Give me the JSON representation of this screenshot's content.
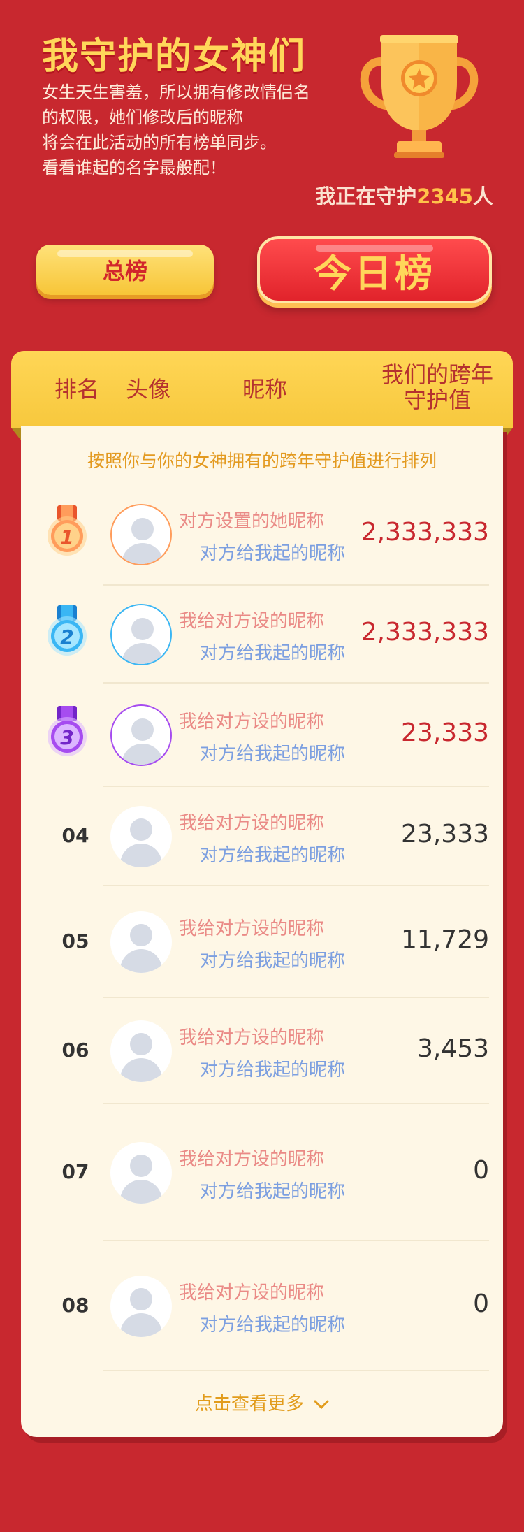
{
  "header": {
    "title": "我守护的女神们",
    "desc_lines": [
      "女生天生害羞，所以拥有修改情侣名",
      "的权限，她们修改后的昵称",
      "将会在此活动的所有榜单同步。",
      "看看谁起的名字最般配！"
    ],
    "guard_prefix": "我正在守护",
    "guard_count": "2345",
    "guard_suffix": "人"
  },
  "tabs": {
    "total": "总榜",
    "today": "今日榜"
  },
  "columns": {
    "rank": "排名",
    "avatar": "头像",
    "nickname": "昵称",
    "value_line1": "我们的跨年",
    "value_line2": "守护值"
  },
  "subtitle": "按照你与你的女神拥有的跨年守护值进行排列",
  "colors": {
    "background": "#c8282f",
    "accent": "#ffd75a",
    "top_score": "#c8282f",
    "normal_score": "#333333"
  },
  "rows": [
    {
      "rank": "1",
      "name": "对方设置的她昵称",
      "alias": "对方给我起的昵称",
      "score": "2,333,333",
      "medal": "orange"
    },
    {
      "rank": "2",
      "name": "我给对方设的昵称",
      "alias": "对方给我起的昵称",
      "score": "2,333,333",
      "medal": "blue"
    },
    {
      "rank": "3",
      "name": "我给对方设的昵称",
      "alias": "对方给我起的昵称",
      "score": "23,333",
      "medal": "purple"
    },
    {
      "rank": "04",
      "name": "我给对方设的昵称",
      "alias": "对方给我起的昵称",
      "score": "23,333"
    },
    {
      "rank": "05",
      "name": "我给对方设的昵称",
      "alias": "对方给我起的昵称",
      "score": "11,729"
    },
    {
      "rank": "06",
      "name": "我给对方设的昵称",
      "alias": "对方给我起的昵称",
      "score": "3,453"
    },
    {
      "rank": "07",
      "name": "我给对方设的昵称",
      "alias": "对方给我起的昵称",
      "score": "0"
    },
    {
      "rank": "08",
      "name": "我给对方设的昵称",
      "alias": "对方给我起的昵称",
      "score": "0"
    }
  ],
  "more": "点击查看更多"
}
